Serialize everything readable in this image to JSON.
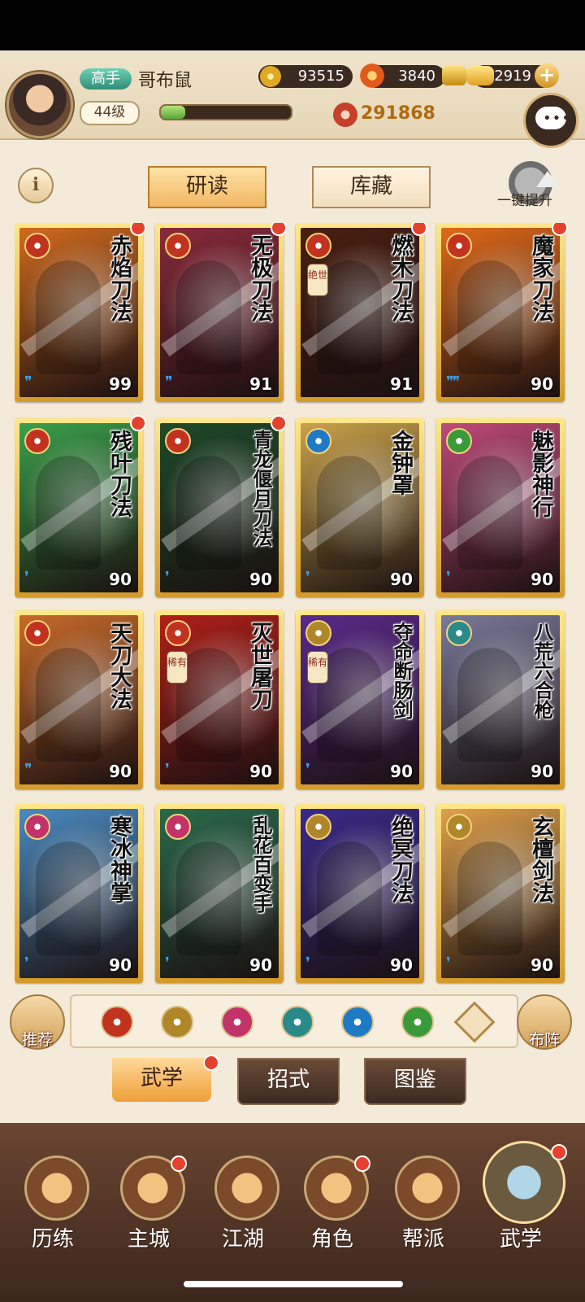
{
  "header": {
    "rank": "高手",
    "player_name": "哥布鼠",
    "level": "44级",
    "exp_fraction": 0.19,
    "coins": "93515",
    "energy": "3840",
    "gold": "2919",
    "power": "291868"
  },
  "tabs": {
    "study": "研读",
    "storage": "库藏",
    "upgrade_all": "一键提升"
  },
  "cards": [
    {
      "name": "赤焰刀法",
      "level": "99",
      "drops": "❜❜",
      "bg": "#d06a1f",
      "badge": "#c2331f",
      "dot": true
    },
    {
      "name": "无极刀法",
      "level": "91",
      "drops": "❜❜",
      "bg": "#8a2a3a",
      "badge": "#c2331f",
      "dot": true
    },
    {
      "name": "燃木刀法",
      "level": "91",
      "drops": "",
      "bg": "#4a1f10",
      "badge": "#c2331f",
      "dot": true,
      "tag": "绝世"
    },
    {
      "name": "魔家刀法",
      "level": "90",
      "drops": "❜❜❜❜",
      "bg": "#e06a1a",
      "badge": "#c2331f",
      "dot": true
    },
    {
      "name": "残叶刀法",
      "level": "90",
      "drops": "❜",
      "bg": "#3aa04a",
      "badge": "#c2331f",
      "dot": true
    },
    {
      "name": "青龙偃月刀法",
      "level": "90",
      "drops": "❜",
      "bg": "#1f4a2a",
      "badge": "#c2331f",
      "dot": true
    },
    {
      "name": "金钟罩",
      "level": "90",
      "drops": "❜",
      "bg": "#c9a24a",
      "badge": "#1f7ac6",
      "dot": false
    },
    {
      "name": "魅影神行",
      "level": "90",
      "drops": "❜",
      "bg": "#c04a7a",
      "badge": "#3a9a3a",
      "dot": false
    },
    {
      "name": "天刀大法",
      "level": "90",
      "drops": "❜❜",
      "bg": "#c86a2a",
      "badge": "#c2331f",
      "dot": false
    },
    {
      "name": "灭世屠刀",
      "level": "90",
      "drops": "❜",
      "bg": "#b01f1a",
      "badge": "#c2331f",
      "dot": false,
      "tag": "稀有"
    },
    {
      "name": "夺命断肠剑",
      "level": "90",
      "drops": "❜",
      "bg": "#5a2a8a",
      "badge": "#b0862a",
      "dot": false,
      "tag": "稀有"
    },
    {
      "name": "八荒六合枪",
      "level": "90",
      "drops": "",
      "bg": "#7a7a9a",
      "badge": "#2a8a8a",
      "dot": false
    },
    {
      "name": "寒冰神掌",
      "level": "90",
      "drops": "❜",
      "bg": "#4a8ac0",
      "badge": "#c2336a",
      "dot": false
    },
    {
      "name": "乱花百变手",
      "level": "90",
      "drops": "❜",
      "bg": "#2a6a4a",
      "badge": "#c2336a",
      "dot": false
    },
    {
      "name": "绝冥刀法",
      "level": "90",
      "drops": "❜",
      "bg": "#3a2a8a",
      "badge": "#b0862a",
      "dot": false
    },
    {
      "name": "玄檀剑法",
      "level": "90",
      "drops": "❜",
      "bg": "#e0a04a",
      "badge": "#b0862a",
      "dot": false
    }
  ],
  "filters": [
    {
      "icon": "blade-icon",
      "color": "#c2331f"
    },
    {
      "icon": "sword-icon",
      "color": "#b0862a"
    },
    {
      "icon": "fist-icon",
      "color": "#c2336a"
    },
    {
      "icon": "fan-icon",
      "color": "#2a8a8a"
    },
    {
      "icon": "yinyang-icon",
      "color": "#1f7ac6"
    },
    {
      "icon": "leaf-icon",
      "color": "#3a9a3a"
    }
  ],
  "side": {
    "recommend": "推荐",
    "formation": "布阵"
  },
  "sub_tabs": {
    "martial": "武学",
    "moves": "招式",
    "codex": "图鉴"
  },
  "nav": {
    "training": "历练",
    "city": "主城",
    "jianghu": "江湖",
    "character": "角色",
    "guild": "帮派",
    "martial": "武学"
  }
}
